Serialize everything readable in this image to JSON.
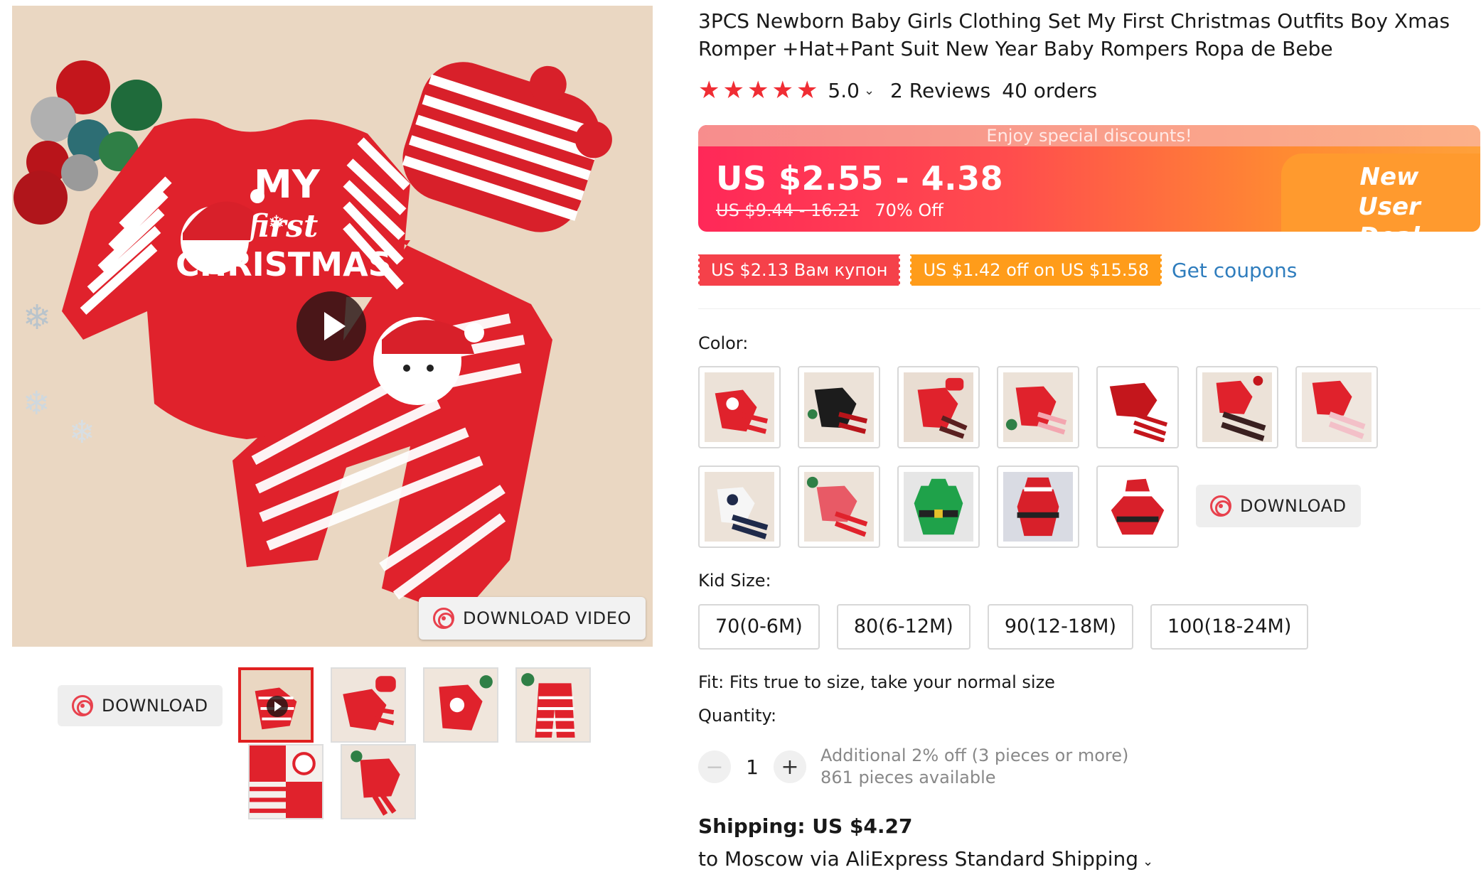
{
  "product": {
    "title": "3PCS Newborn Baby Girls Clothing Set My First Christmas Outfits Boy Xmas Romper +Hat+Pant Suit New Year Baby Rompers Ropa de Bebe",
    "main_image_text": {
      "line1": "MY",
      "line2": "first",
      "line3": "CHRISTMAS"
    }
  },
  "rating": {
    "stars": [
      "★",
      "★",
      "★",
      "★",
      "★"
    ],
    "score": "5.0",
    "chevron": "⌄",
    "reviews": "2 Reviews",
    "orders": "40 orders",
    "star_color": "#f02d34"
  },
  "price": {
    "banner": "Enjoy special discounts!",
    "current": "US $2.55 - 4.38",
    "original": "US $9.44 - 16.21",
    "discount": "70% Off",
    "deal_line1": "New User",
    "deal_line2": "Deal"
  },
  "coupons": {
    "items": [
      "US $2.13 Вам купон",
      "US $1.42 off on US $15.58"
    ],
    "get": "Get coupons"
  },
  "color": {
    "label": "Color:"
  },
  "download": {
    "main": "DOWNLOAD",
    "video": "DOWNLOAD VIDEO",
    "gallery": "DOWNLOAD"
  },
  "size": {
    "label": "Kid Size:",
    "options": [
      "70(0-6M)",
      "80(6-12M)",
      "90(12-18M)",
      "100(18-24M)"
    ]
  },
  "fit": "Fit: Fits true to size, take your normal size",
  "quantity": {
    "label": "Quantity:",
    "minus": "−",
    "value": "1",
    "plus": "+",
    "extra": "Additional 2% off (3 pieces or more)",
    "available": "861 pieces available"
  },
  "shipping": {
    "price": "Shipping: US $4.27",
    "to": "to Moscow via AliExpress Standard Shipping",
    "chevron": "⌄"
  },
  "colors": {
    "accent": "#e02020",
    "price_gradient_start": "#ff2858",
    "price_gradient_end": "#ffa13a",
    "link": "#2f7dbd"
  }
}
